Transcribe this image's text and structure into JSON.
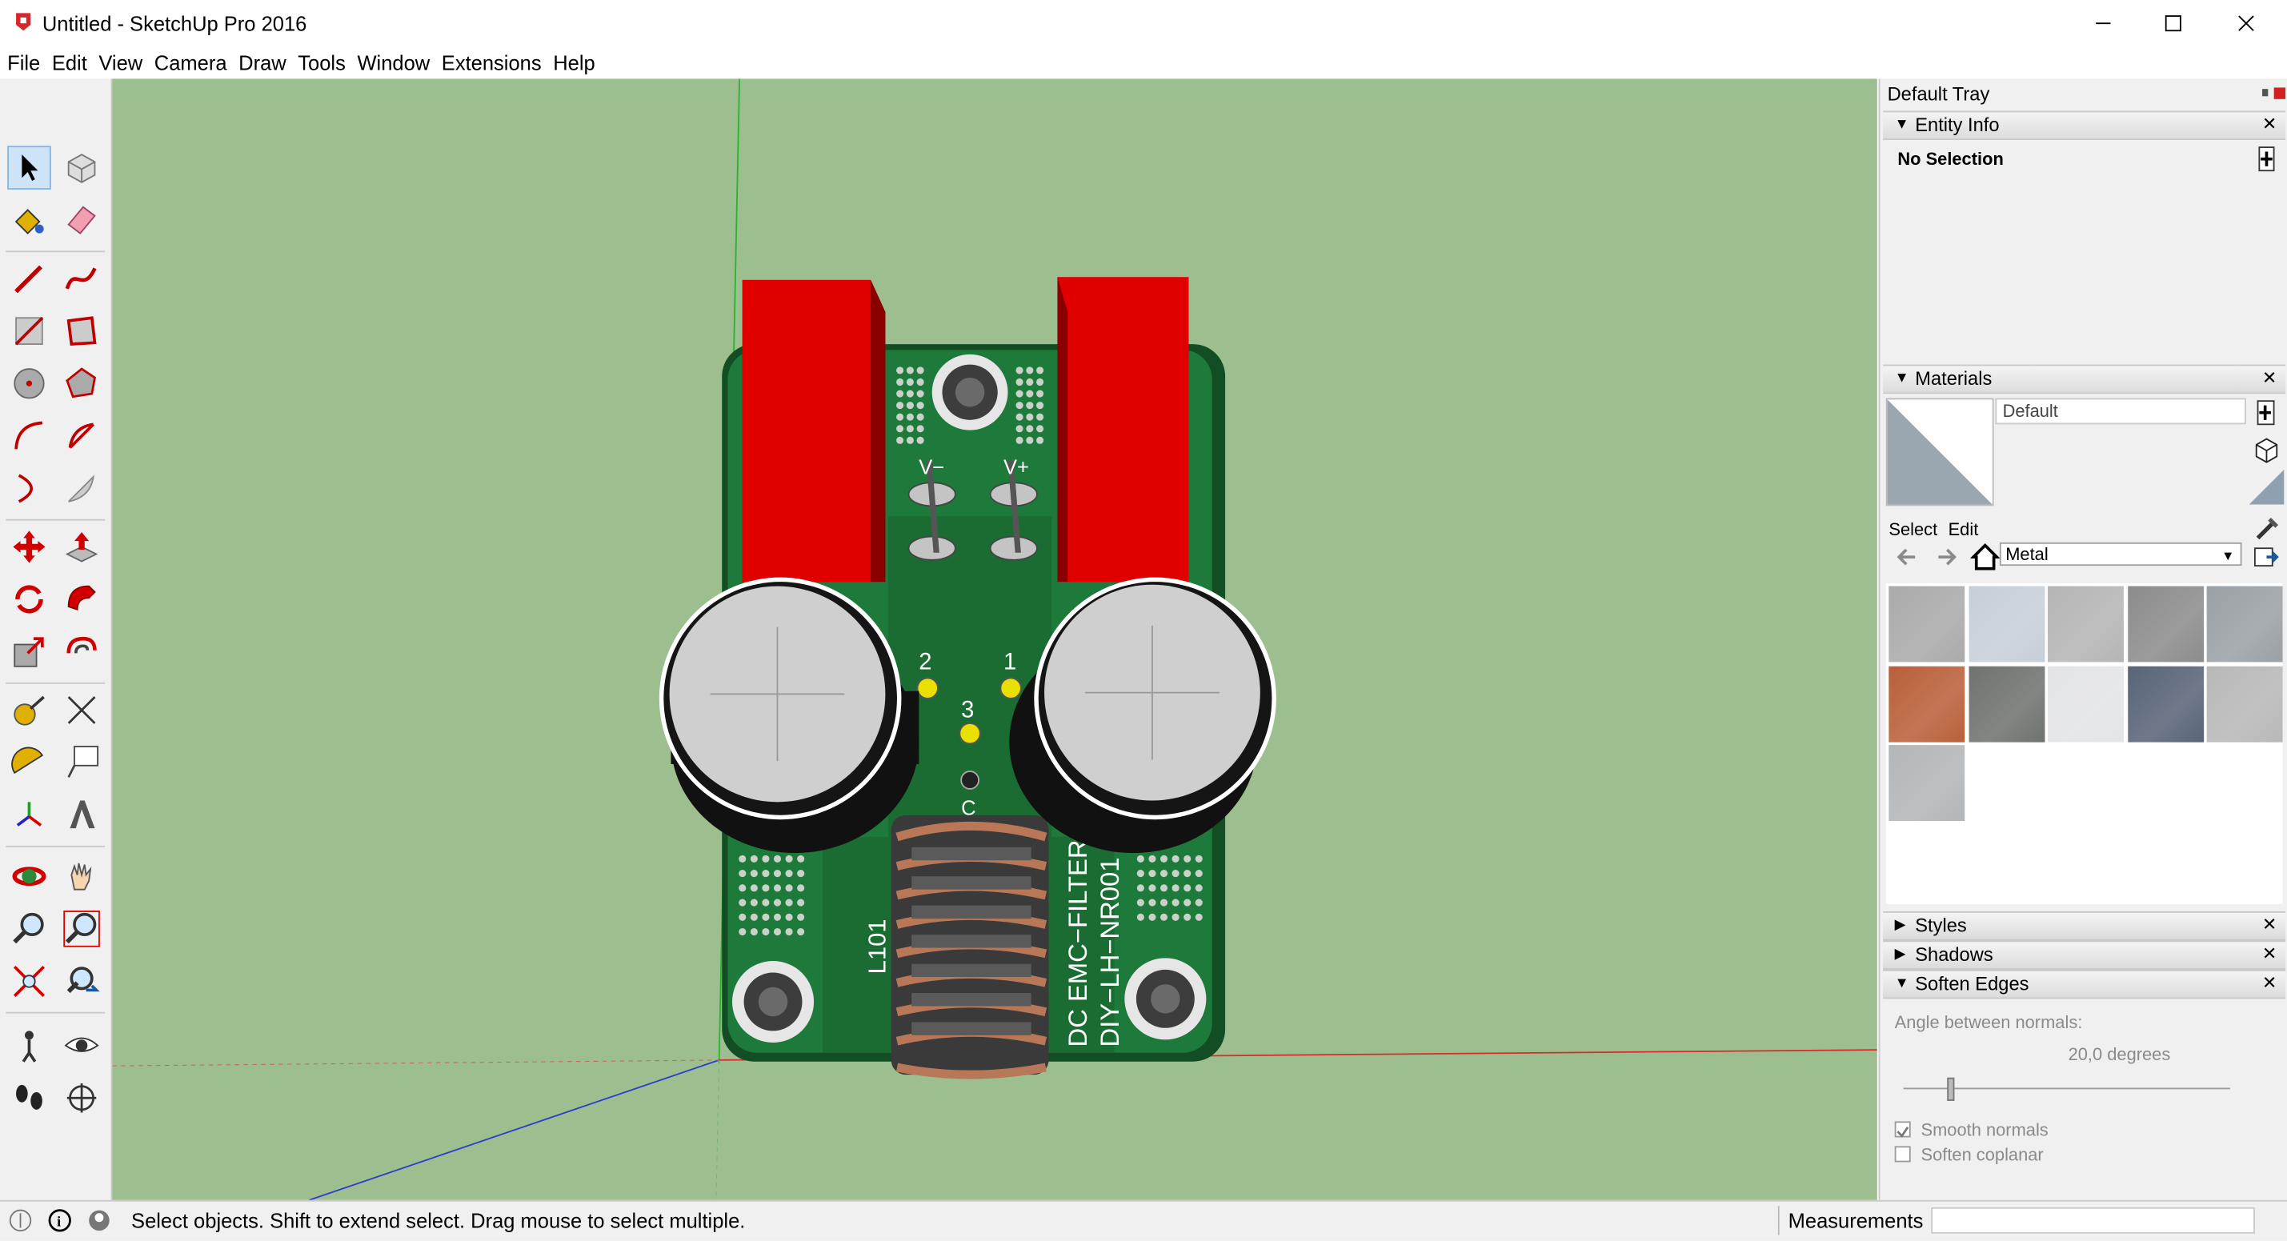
{
  "window": {
    "title": "Untitled - SketchUp Pro 2016",
    "controls": [
      "minimize-icon",
      "maximize-icon",
      "close-icon"
    ]
  },
  "menu": [
    "File",
    "Edit",
    "View",
    "Camera",
    "Draw",
    "Tools",
    "Window",
    "Extensions",
    "Help"
  ],
  "toolbar": {
    "tools": [
      "select-icon",
      "make-component-icon",
      "paint-bucket-icon",
      "eraser-icon",
      "line-icon",
      "freehand-icon",
      "rectangle-icon",
      "rotated-rectangle-icon",
      "circle-icon",
      "polygon-icon",
      "arc-icon",
      "pie-icon",
      "2-point-arc-icon",
      "3-point-arc-icon",
      "move-icon",
      "push-pull-icon",
      "rotate-icon",
      "follow-me-icon",
      "scale-icon",
      "offset-icon",
      "tape-measure-icon",
      "dimension-icon",
      "protractor-icon",
      "text-icon",
      "axes-icon",
      "3d-text-icon",
      "orbit-icon",
      "pan-icon",
      "zoom-icon",
      "zoom-window-icon",
      "zoom-extents-icon",
      "previous-view-icon",
      "position-camera-icon",
      "look-around-icon",
      "walk-icon",
      "section-plane-icon"
    ],
    "active_tool": "select-icon"
  },
  "model": {
    "pcb_labels": {
      "v_minus": "V−",
      "v_plus": "V+",
      "pin2": "2",
      "pin1": "1",
      "pin3": "3",
      "pinc": "C",
      "coil": "L101",
      "product_line1": "DC EMC−FILTER",
      "product_line2": "DIY−LH−NR001"
    },
    "colors": {
      "background": "#9dbf8f",
      "pcb": "#1d7a3a",
      "capacitor_red": "#e00000",
      "can_top": "#c9c9c9",
      "coil_copper": "#b87858"
    }
  },
  "tray": {
    "title": "Default Tray",
    "entity_info": {
      "header": "Entity Info",
      "selection": "No Selection"
    },
    "materials": {
      "header": "Materials",
      "current_name": "Default",
      "tab_select": "Select",
      "tab_edit": "Edit",
      "library": "Metal",
      "swatch_colors": [
        "#aaaaaa",
        "#c6cfd8",
        "#b5b5b5",
        "#8c8c8c",
        "#9aa1a6",
        "#b9603a",
        "#6f7370",
        "#e3e4e8",
        "#596478",
        "#b8b8b8",
        "#b3b6b8"
      ]
    },
    "styles": {
      "header": "Styles"
    },
    "shadows": {
      "header": "Shadows"
    },
    "soften_edges": {
      "header": "Soften Edges",
      "angle_label": "Angle between normals:",
      "angle_value": "20,0  degrees",
      "smooth_normals": "Smooth normals",
      "soften_coplanar": "Soften coplanar",
      "smooth_normals_checked": true,
      "soften_coplanar_checked": false
    }
  },
  "status": {
    "message": "Select objects. Shift to extend select. Drag mouse to select multiple.",
    "measurements_label": "Measurements",
    "measurements_value": ""
  }
}
